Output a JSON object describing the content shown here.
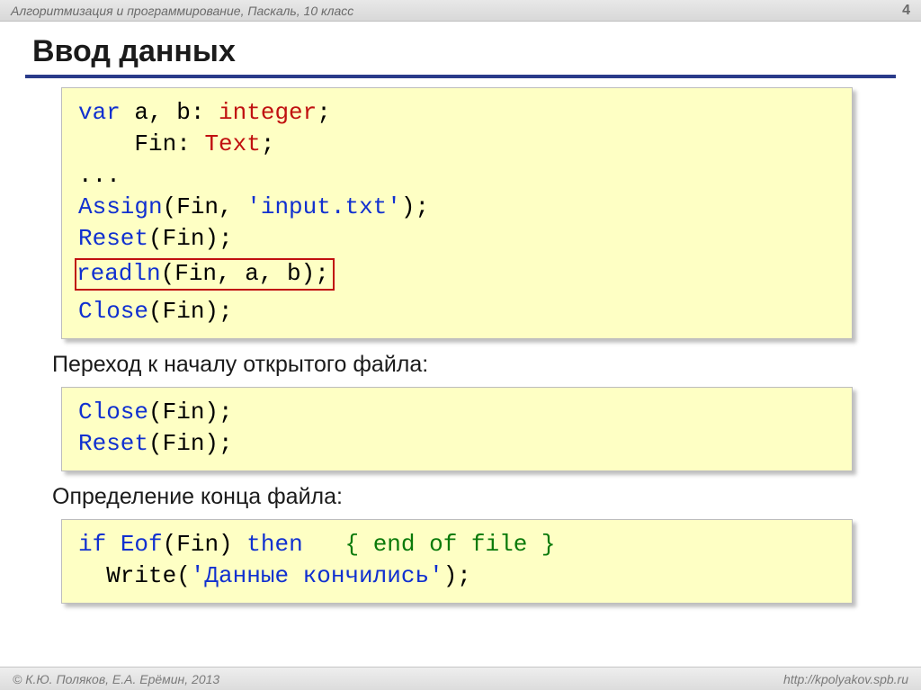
{
  "header": {
    "breadcrumb": "Алгоритмизация и программирование, Паскаль, 10 класс",
    "pagenum": "4"
  },
  "title": "Ввод данных",
  "code1": {
    "l1a": "var",
    "l1b": " a, b: ",
    "l1c": "integer",
    "l1d": ";",
    "l2a": "    Fin: ",
    "l2b": "Text",
    "l2c": ";",
    "l3": "...",
    "l4a": "Assign",
    "l4b": "(Fin, ",
    "l4c": "'input.txt'",
    "l4d": ");",
    "l5a": "Reset",
    "l5b": "(Fin);",
    "l6a": "readln",
    "l6b": "(Fin, a, b);",
    "l7a": "Close",
    "l7b": "(Fin);"
  },
  "caption1": "Переход к началу открытого файла:",
  "code2": {
    "l1a": "Close",
    "l1b": "(Fin);",
    "l2a": "Reset",
    "l2b": "(Fin);"
  },
  "caption2": "Определение конца файла:",
  "code3": {
    "l1a": "if",
    "l1b": " ",
    "l1c": "Eof",
    "l1d": "(Fin) ",
    "l1e": "then",
    "l1f": "   ",
    "l1g": "{ end of file }",
    "l2a": "  Write(",
    "l2b": "'Данные кончились'",
    "l2c": ");"
  },
  "footer": {
    "left": "© К.Ю. Поляков, Е.А. Ерёмин, 2013",
    "right": "http://kpolyakov.spb.ru"
  }
}
